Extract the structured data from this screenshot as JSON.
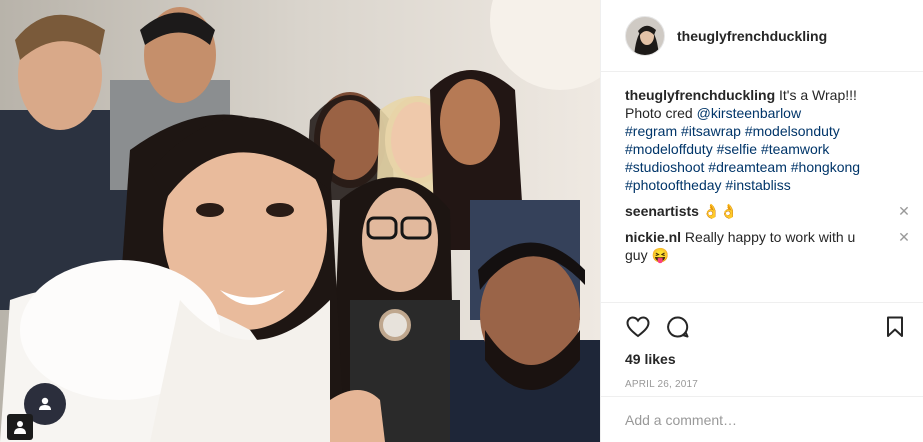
{
  "photo": {
    "alt_icon": "person-icon"
  },
  "header": {
    "username": "theuglyfrenchduckling"
  },
  "caption": {
    "username": "theuglyfrenchduckling",
    "text": " It's a Wrap!!! Photo cred ",
    "mention": "@kirsteenbarlow",
    "hashtags": "#regram #itsawrap #modelsonduty #modeloffduty #selfie #teamwork #studioshoot #dreamteam #hongkong #photooftheday #instabliss"
  },
  "comments": [
    {
      "username": "seenartists",
      "text": " 👌👌"
    },
    {
      "username": "nickie.nl",
      "text": " Really happy to work with u guy 😝"
    }
  ],
  "actions": {
    "likes": "49 likes",
    "date": "APRIL 26, 2017"
  },
  "add_comment": {
    "placeholder": "Add a comment…"
  },
  "colors": {
    "link": "#003569",
    "muted": "#999999",
    "border": "#efefef"
  }
}
